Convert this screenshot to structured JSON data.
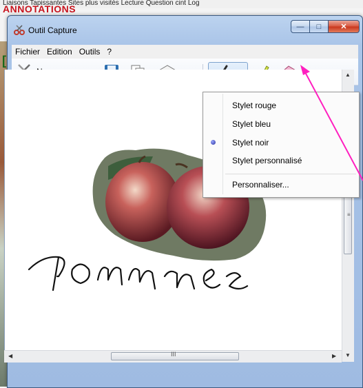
{
  "background": {
    "bookmarks_text": "Liaisons  Tapissantes  Sites plus visités  Lecture  Question cint Log",
    "annotation_title": "ANNOTATIONS"
  },
  "window": {
    "title": "Outil Capture",
    "caption": {
      "minimize": "—",
      "maximize": "□",
      "close": "✕"
    }
  },
  "menu": [
    "Fichier",
    "Edition",
    "Outils",
    "?"
  ],
  "toolbar": {
    "new_label": "Nouveau",
    "new_accesskey": "N",
    "icons": [
      "scissors-icon",
      "save-icon",
      "copy-icon",
      "send-email-icon",
      "pen-icon",
      "highlighter-icon",
      "eraser-icon"
    ]
  },
  "pen_menu": {
    "items": [
      "Stylet rouge",
      "Stylet bleu",
      "Stylet noir",
      "Stylet personnalisé"
    ],
    "selected": "Stylet noir",
    "customize": "Personnaliser..."
  },
  "canvas": {
    "handwriting": "pommes",
    "image_subject": "apples"
  },
  "colors": {
    "annotation_arrow": "#ff1fbf",
    "annotation_title": "#c8141e",
    "window_frame": "#a9c4e8"
  }
}
